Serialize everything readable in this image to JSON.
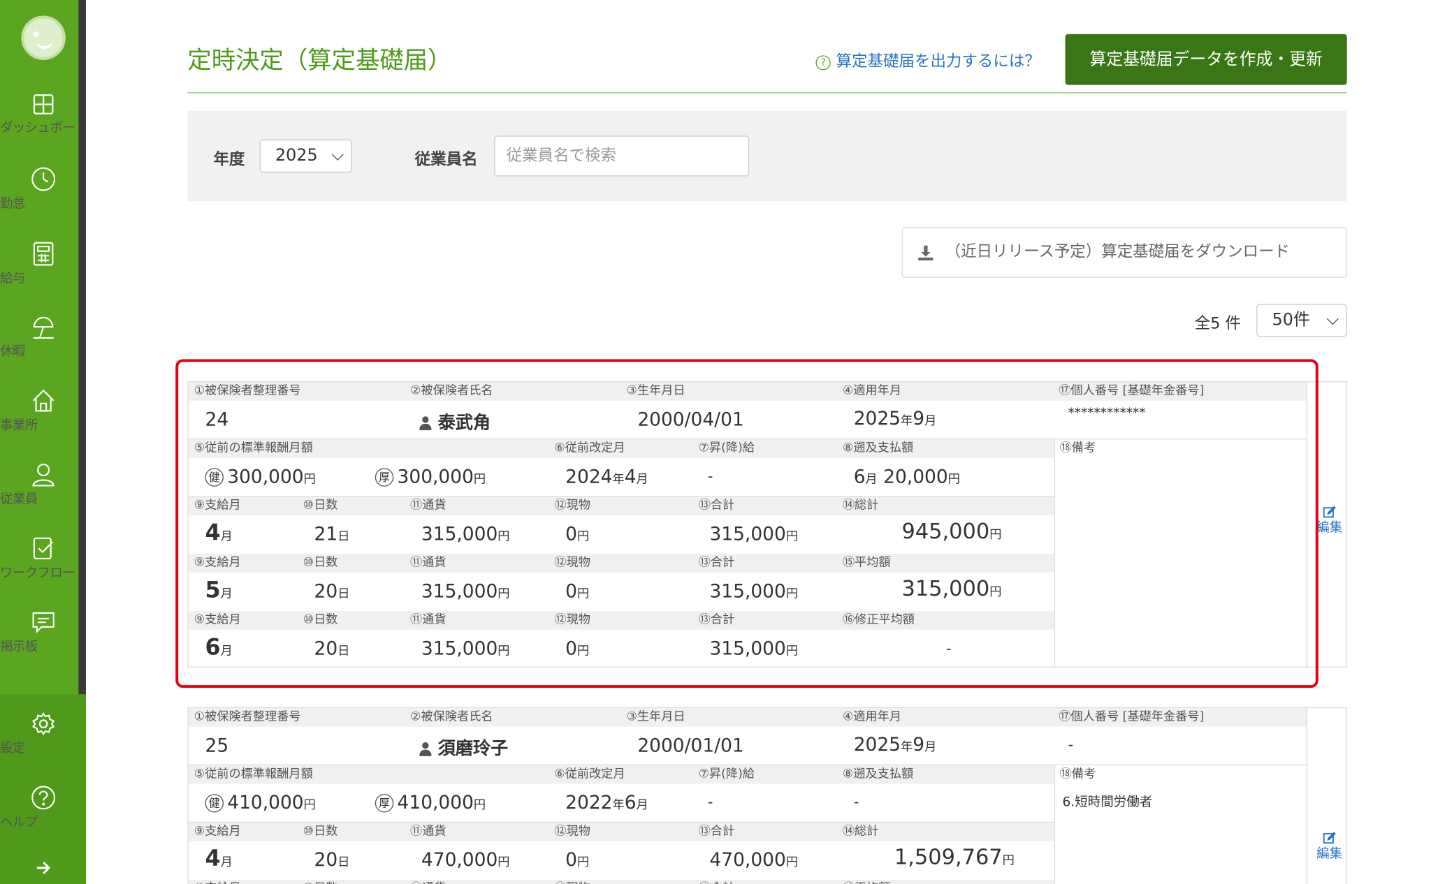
{
  "sidebar": {
    "items": [
      {
        "label": "ダッシュボード",
        "icon": "dashboard-icon"
      },
      {
        "label": "勤怠",
        "icon": "clock-icon"
      },
      {
        "label": "給与",
        "icon": "calculator-icon"
      },
      {
        "label": "休暇",
        "icon": "beach-umbrella-icon"
      },
      {
        "label": "事業所",
        "icon": "home-icon"
      },
      {
        "label": "従業員",
        "icon": "person-icon"
      },
      {
        "label": "ワークフロー",
        "icon": "workflow-check-icon"
      },
      {
        "label": "掲示板",
        "icon": "chat-icon"
      }
    ],
    "bottom": [
      {
        "label": "設定",
        "icon": "gear-icon"
      },
      {
        "label": "ヘルプ",
        "icon": "help-icon"
      }
    ],
    "collapse_icon": "arrow-right-icon",
    "colors": {
      "bg": "#5aa620",
      "bottom_bg": "#4f9a1a"
    }
  },
  "header": {
    "title": "定時決定（算定基礎届）",
    "help_link": "算定基礎届を出力するには？",
    "create_button": "算定基礎届データを作成・更新"
  },
  "filter": {
    "year_label": "年度",
    "year_value": "2025",
    "employee_label": "従業員名",
    "employee_placeholder": "従業員名で検索"
  },
  "download_button": "（近日リリース予定）算定基礎届をダウンロード",
  "count_text": "全5 件",
  "per_page": "50件",
  "labels": {
    "insured_no": "①被保険者整理番号",
    "name": "②被保険者氏名",
    "birth": "③生年月日",
    "apply_ym": "④適用年月",
    "personal_no": "⑰個人番号 [基礎年金番号]",
    "prev_std": "⑤従前の標準報酬月額",
    "prev_revision": "⑥従前改定月",
    "raise": "⑦昇(降)給",
    "retro": "⑧遡及支払額",
    "remarks": "⑱備考",
    "pay_month": "⑨支給月",
    "days": "⑩日数",
    "currency": "⑪通貨",
    "inkind": "⑫現物",
    "subtotal": "⑬合計",
    "total": "⑭総計",
    "average": "⑮平均額",
    "mod_average": "⑯修正平均額",
    "health_mark": "健",
    "pension_mark": "厚",
    "edit": "編集"
  },
  "records": [
    {
      "insured_no": "24",
      "name": "泰武角",
      "birth": "2000/04/01",
      "apply_year": "2025",
      "apply_month": "9",
      "personal_no": "************",
      "prev_health": "300,000",
      "prev_pension": "300,000",
      "prev_rev_year": "2024",
      "prev_rev_month": "4",
      "raise": "-",
      "retro_month": "6",
      "retro_amount": "20,000",
      "remarks": "",
      "months": [
        {
          "month": "4",
          "days": "21",
          "currency": "315,000",
          "inkind": "0",
          "subtotal": "315,000"
        },
        {
          "month": "5",
          "days": "20",
          "currency": "315,000",
          "inkind": "0",
          "subtotal": "315,000"
        },
        {
          "month": "6",
          "days": "20",
          "currency": "315,000",
          "inkind": "0",
          "subtotal": "315,000"
        }
      ],
      "total": "945,000",
      "average": "315,000",
      "mod_average": "-"
    },
    {
      "insured_no": "25",
      "name": "須磨玲子",
      "birth": "2000/01/01",
      "apply_year": "2025",
      "apply_month": "9",
      "personal_no": "-",
      "prev_health": "410,000",
      "prev_pension": "410,000",
      "prev_rev_year": "2022",
      "prev_rev_month": "6",
      "raise": "-",
      "retro": "-",
      "remarks": "6.短時間労働者",
      "months": [
        {
          "month": "4",
          "days": "20",
          "currency": "470,000",
          "inkind": "0",
          "subtotal": "470,000"
        }
      ],
      "total": "1,509,767"
    }
  ],
  "units": {
    "yen": "円",
    "month": "月",
    "day": "日",
    "year": "年"
  },
  "colors": {
    "accent": "#4f9a1a",
    "button": "#3a7615",
    "link": "#2673c6",
    "highlight": "#e60012"
  }
}
